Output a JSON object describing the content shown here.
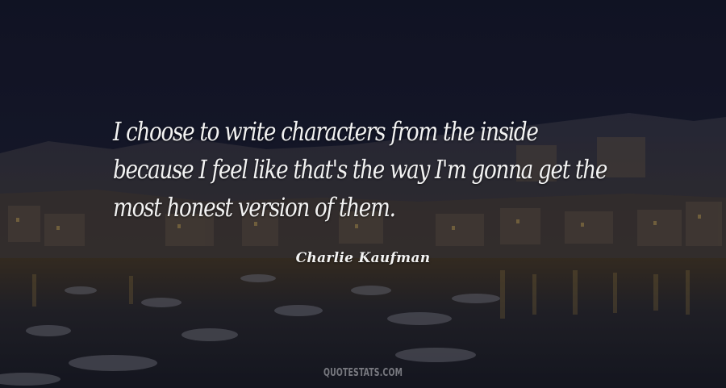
{
  "quote": {
    "lines": [
      "I choose to write characters from the inside",
      "because I feel like that's the way I'm gonna get the",
      "most honest version of them."
    ]
  },
  "author": "Charlie Kaufman",
  "watermark": "QUOTESTATS.COM",
  "colors": {
    "text": "#f2f2f2",
    "sky": "#1a1c2e",
    "water_glow": "#b8923a"
  }
}
